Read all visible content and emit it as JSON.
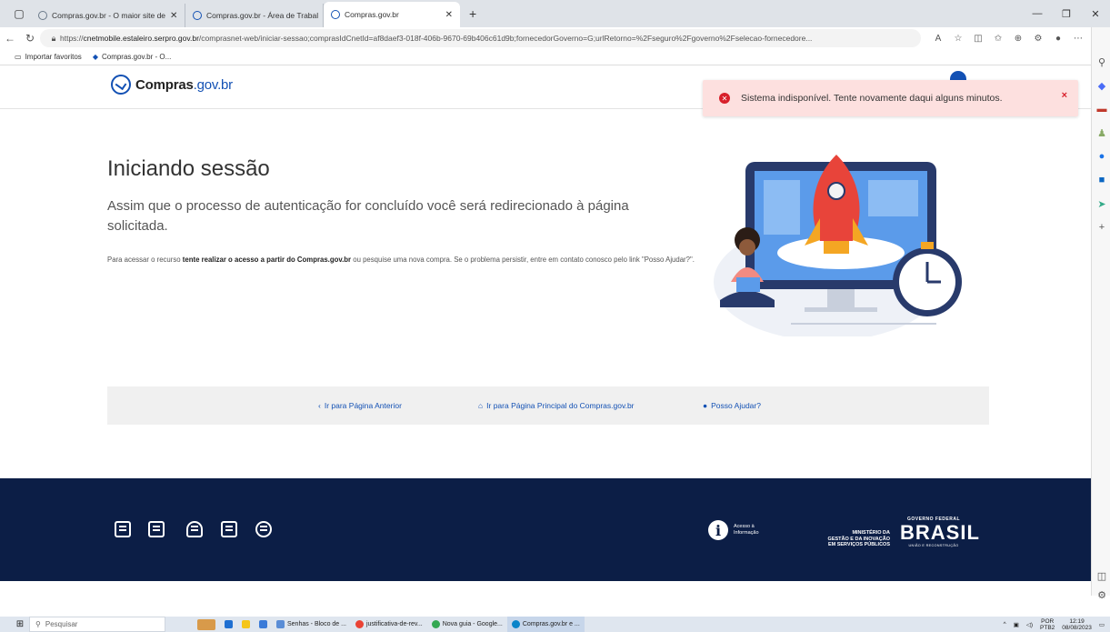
{
  "browser": {
    "tabs": [
      {
        "title": "Compras.gov.br - O maior site de"
      },
      {
        "title": "Compras.gov.br - Área de Trabal"
      },
      {
        "title": "Compras.gov.br"
      }
    ],
    "url_prefix": "https://",
    "url_host": "cnetmobile.estaleiro.serpro.gov.br",
    "url_path": "/comprasnet-web/iniciar-sessao;comprasIdCnetId=af8daef3-018f-406b-9670-69b406c61d9b;fornecedorGoverno=G;urlRetorno=%2Fseguro%2Fgoverno%2Fselecao-fornecedore...",
    "favorites": [
      "Importar favoritos",
      "Compras.gov.br - O..."
    ]
  },
  "page": {
    "logo": {
      "brand": "Compras",
      "suffix": ".gov.br"
    },
    "toast": {
      "message": "Sistema indisponível. Tente novamente daqui alguns minutos.",
      "close": "×"
    },
    "title": "Iniciando sessão",
    "lead": "Assim que o processo de autenticação for concluído você será redirecionado à página solicitada.",
    "note": {
      "before": "Para acessar o recurso ",
      "bold": "tente realizar o acesso a partir do Compras.gov.br",
      "after": " ou pesquise uma nova compra. Se o problema persistir, entre em contato conosco pelo link \"Posso Ajudar?\"."
    },
    "nav": {
      "previous": "Ir para Página Anterior",
      "home": "Ir para Página Principal do Compras.gov.br",
      "help": "Posso Ajudar?"
    }
  },
  "footer": {
    "acesso": [
      "Acesso à",
      "Informação"
    ],
    "ministerio": [
      "MINISTÉRIO DA",
      "GESTÃO E DA INOVAÇÃO",
      "EM SERVIÇOS PÚBLICOS"
    ],
    "governo": "GOVERNO FEDERAL",
    "brasil": "BRASIL",
    "uniao": "UNIÃO E RECONSTRUÇÃO"
  },
  "taskbar": {
    "search_placeholder": "Pesquisar",
    "apps": [
      "Senhas - Bloco de ...",
      "justificativa-de-rev...",
      "Nova guia - Google...",
      "Compras.gov.br e ..."
    ],
    "lang": "POR",
    "lang2": "PTB2",
    "time": "12:19",
    "date": "08/08/2023"
  }
}
